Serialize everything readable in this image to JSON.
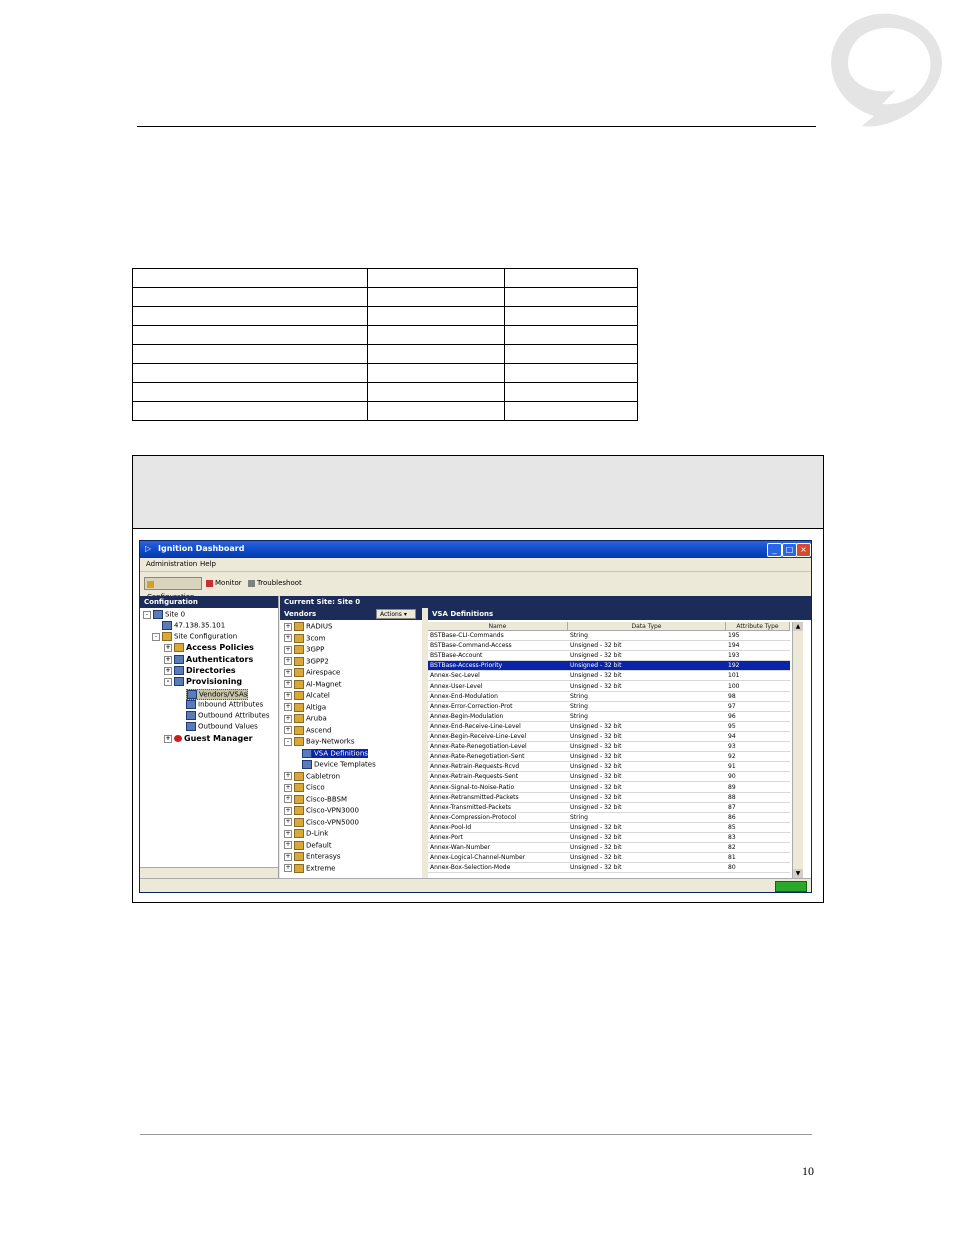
{
  "page": {
    "page_number": "10"
  },
  "app": {
    "title": "Ignition Dashboard",
    "menu": [
      "Administration",
      "Help"
    ],
    "toolbar": [
      "Configuration",
      "Monitor",
      "Troubleshoot"
    ]
  },
  "left_pane": {
    "header": "Configuration",
    "items": [
      "Site 0",
      "47.138.35.101",
      "Site Configuration",
      "Access Policies",
      "Authenticators",
      "Directories",
      "Provisioning",
      "Vendors/VSAs",
      "Inbound Attributes",
      "Outbound Attributes",
      "Outbound Values",
      "Guest Manager"
    ]
  },
  "current_site": "Current Site: Site 0",
  "vendors": {
    "header": "Vendors",
    "actions_label": "Actions",
    "items": [
      "RADIUS",
      "3com",
      "3GPP",
      "3GPP2",
      "Airespace",
      "Al-Magnet",
      "Alcatel",
      "Altiga",
      "Aruba",
      "Ascend",
      "Bay-Networks",
      "VSA Definitions",
      "Device Templates",
      "Cabletron",
      "Cisco",
      "Cisco-BBSM",
      "Cisco-VPN3000",
      "Cisco-VPN5000",
      "D-Link",
      "Default",
      "Enterasys",
      "Extreme"
    ]
  },
  "vsa": {
    "header": "VSA Definitions",
    "columns": [
      "Name",
      "Data Type",
      "Attribute Type"
    ],
    "rows": [
      [
        "BSTBase-CLI-Commands",
        "String",
        "195"
      ],
      [
        "BSTBase-Command-Access",
        "Unsigned - 32 bit",
        "194"
      ],
      [
        "BSTBase-Account",
        "Unsigned - 32 bit",
        "193"
      ],
      [
        "BSTBase-Access-Priority",
        "Unsigned - 32 bit",
        "192"
      ],
      [
        "Annex-Sec-Level",
        "Unsigned - 32 bit",
        "101"
      ],
      [
        "Annex-User-Level",
        "Unsigned - 32 bit",
        "100"
      ],
      [
        "Annex-End-Modulation",
        "String",
        "98"
      ],
      [
        "Annex-Error-Correction-Prot",
        "String",
        "97"
      ],
      [
        "Annex-Begin-Modulation",
        "String",
        "96"
      ],
      [
        "Annex-End-Receive-Line-Level",
        "Unsigned - 32 bit",
        "95"
      ],
      [
        "Annex-Begin-Receive-Line-Level",
        "Unsigned - 32 bit",
        "94"
      ],
      [
        "Annex-Rate-Renegotiation-Level",
        "Unsigned - 32 bit",
        "93"
      ],
      [
        "Annex-Rate-Renegotiation-Sent",
        "Unsigned - 32 bit",
        "92"
      ],
      [
        "Annex-Retrain-Requests-Rcvd",
        "Unsigned - 32 bit",
        "91"
      ],
      [
        "Annex-Retrain-Requests-Sent",
        "Unsigned - 32 bit",
        "90"
      ],
      [
        "Annex-Signal-to-Noise-Ratio",
        "Unsigned - 32 bit",
        "89"
      ],
      [
        "Annex-Retransmitted-Packets",
        "Unsigned - 32 bit",
        "88"
      ],
      [
        "Annex-Transmitted-Packets",
        "Unsigned - 32 bit",
        "87"
      ],
      [
        "Annex-Compression-Protocol",
        "String",
        "86"
      ],
      [
        "Annex-Pool-Id",
        "Unsigned - 32 bit",
        "85"
      ],
      [
        "Annex-Port",
        "Unsigned - 32 bit",
        "83"
      ],
      [
        "Annex-Wan-Number",
        "Unsigned - 32 bit",
        "82"
      ],
      [
        "Annex-Logical-Channel-Number",
        "Unsigned - 32 bit",
        "81"
      ],
      [
        "Annex-Box-Selection-Mode",
        "Unsigned - 32 bit",
        "80"
      ]
    ]
  }
}
